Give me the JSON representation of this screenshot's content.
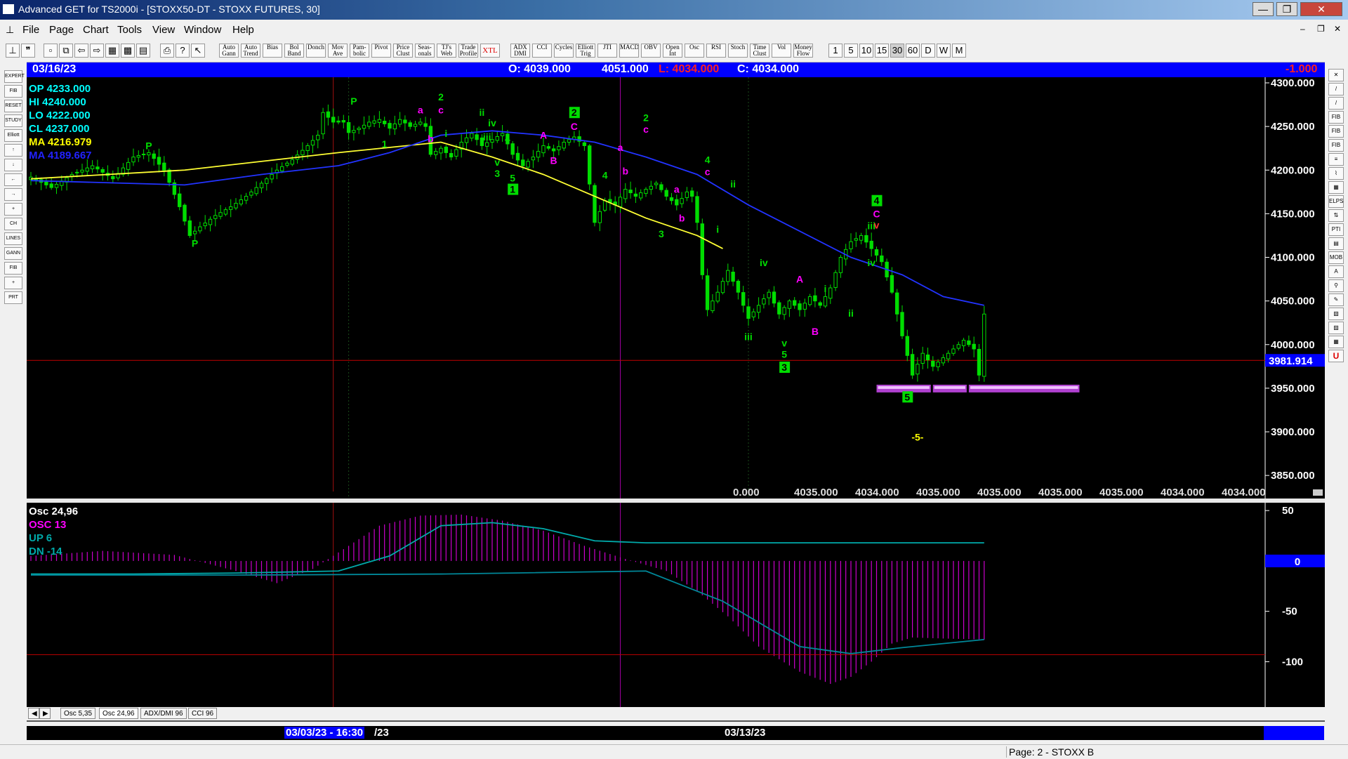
{
  "window": {
    "title": "Advanced GET for TS2000i - [STOXX50-DT - STOXX FUTURES, 30]",
    "controls": [
      "—",
      "❐",
      "✕"
    ]
  },
  "menu": [
    "File",
    "Page",
    "Chart",
    "Tools",
    "View",
    "Window",
    "Help"
  ],
  "toolbar": {
    "studies": [
      "Auto Gann",
      "Auto Trend",
      "Bias",
      "Bol Band",
      "Donch",
      "Mov Ave",
      "Pam-bolic",
      "Pivot",
      "Price Clust",
      "Seas-onals",
      "TJ's Web",
      "Trade Profile",
      "XTL",
      "ADX DMI",
      "CCI",
      "Cycles",
      "Elliott Trig",
      "JTI",
      "MACD",
      "OBV",
      "Open Int",
      "Osc",
      "RSI",
      "Stoch",
      "Time Clust",
      "Vol",
      "Money Flow"
    ],
    "intervals": [
      "1",
      "5",
      "10",
      "15",
      "30",
      "60",
      "D",
      "W",
      "M"
    ],
    "selected_interval": "30"
  },
  "left_tools": [
    "EXPERT",
    "FIB",
    "RESET",
    "STUDY",
    "Elliott",
    "↑",
    "↓",
    "←",
    "→",
    "+",
    "CH",
    "LINES",
    "GANN",
    "FIB",
    "+",
    "PRT"
  ],
  "right_tools": [
    "✕",
    "/",
    "/",
    "FIB RET",
    "FIB EXT",
    "FIB TIME",
    "≡",
    "⌇",
    "▦",
    "ELPS",
    "⇅",
    "PTI",
    "▤",
    "MOB",
    "A",
    "⚲",
    "✎",
    "▧",
    "▨",
    "▦",
    "U"
  ],
  "info_bar": {
    "date": "03/16/23",
    "open": "O: 4039.000",
    "high": "4051.000",
    "low": "L: 4034.000",
    "close": "C: 4034.000",
    "change": "-1.000"
  },
  "price_legend": [
    {
      "text": "OP  4233.000",
      "color": "#00ffff"
    },
    {
      "text": "HI   4240.000",
      "color": "#00ffff"
    },
    {
      "text": "LO  4222.000",
      "color": "#00ffff"
    },
    {
      "text": "CL  4237.000",
      "color": "#00ffff"
    },
    {
      "text": "MA  4216.979",
      "color": "#ffff00"
    },
    {
      "text": "MA  4189.667",
      "color": "#2222ff"
    }
  ],
  "cursor_price": "3981.914",
  "price_footer": [
    "0.000",
    "4035.000",
    "4034.000",
    "4035.000",
    "4035.000",
    "4035.000",
    "4035.000",
    "4034.000",
    "4034.000"
  ],
  "osc_legend": [
    {
      "text": "Osc 24,96",
      "color": "#ffffff"
    },
    {
      "text": "OSC 13",
      "color": "#ff00ff"
    },
    {
      "text": "UP   6",
      "color": "#00aaaa"
    },
    {
      "text": "DN   -14",
      "color": "#00aaaa"
    }
  ],
  "osc_zero_label": "0",
  "tabs": [
    "Osc 5,35",
    "Osc 24,96",
    "ADX/DMI 96",
    "CCI 96"
  ],
  "selected_tab": "Osc 24,96",
  "date_axis": [
    "03/03/23 - 16:30",
    "/23",
    "03/13/23"
  ],
  "status": "Page: 2 - STOXX B",
  "chart_data": [
    {
      "type": "candlestick",
      "title": "STOXX50-DT - STOXX FUTURES, 30",
      "ylim": [
        3830,
        4300
      ],
      "yticks": [
        3850,
        3900,
        3950,
        4000,
        4050,
        4100,
        4150,
        4200,
        4250,
        4300
      ],
      "ytick_labels": [
        "3850.000",
        "3900.000",
        "3950.000",
        "4000.000",
        "4050.000",
        "4100.000",
        "4150.000",
        "4200.000",
        "4250.000",
        "4300.000"
      ],
      "bar_count": 122,
      "close_path": [
        [
          0,
          4192
        ],
        [
          4,
          4180
        ],
        [
          8,
          4195
        ],
        [
          12,
          4205
        ],
        [
          16,
          4190
        ],
        [
          20,
          4215
        ],
        [
          23,
          4220
        ],
        [
          26,
          4200
        ],
        [
          29,
          4158
        ],
        [
          31,
          4125
        ],
        [
          33,
          4135
        ],
        [
          36,
          4148
        ],
        [
          39,
          4158
        ],
        [
          42,
          4170
        ],
        [
          45,
          4185
        ],
        [
          48,
          4200
        ],
        [
          51,
          4212
        ],
        [
          54,
          4228
        ],
        [
          56,
          4240
        ],
        [
          57,
          4266
        ],
        [
          59,
          4255
        ],
        [
          61,
          4255
        ],
        [
          62,
          4243
        ],
        [
          64,
          4248
        ],
        [
          66,
          4255
        ],
        [
          68,
          4258
        ],
        [
          70,
          4248
        ],
        [
          72,
          4258
        ],
        [
          74,
          4250
        ],
        [
          76,
          4255
        ],
        [
          77,
          4250
        ],
        [
          78,
          4218
        ],
        [
          80,
          4225
        ],
        [
          82,
          4215
        ],
        [
          84,
          4232
        ],
        [
          86,
          4242
        ],
        [
          88,
          4228
        ],
        [
          90,
          4235
        ],
        [
          92,
          4242
        ],
        [
          94,
          4218
        ],
        [
          96,
          4205
        ],
        [
          98,
          4215
        ],
        [
          100,
          4228
        ],
        [
          102,
          4222
        ],
        [
          104,
          4232
        ],
        [
          106,
          4238
        ],
        [
          108,
          4228
        ],
        [
          110,
          4140
        ],
        [
          112,
          4165
        ],
        [
          114,
          4160
        ],
        [
          116,
          4178
        ],
        [
          118,
          4170
        ],
        [
          120,
          4178
        ],
        [
          122,
          4185
        ],
        [
          124,
          4170
        ],
        [
          126,
          4160
        ],
        [
          128,
          4175
        ],
        [
          129,
          4170
        ],
        [
          130,
          4140
        ],
        [
          131,
          4080
        ],
        [
          132,
          4040
        ],
        [
          134,
          4060
        ],
        [
          136,
          4085
        ],
        [
          138,
          4060
        ],
        [
          140,
          4030
        ],
        [
          142,
          4045
        ],
        [
          144,
          4060
        ],
        [
          146,
          4035
        ],
        [
          148,
          4050
        ],
        [
          150,
          4040
        ],
        [
          152,
          4055
        ],
        [
          154,
          4045
        ],
        [
          156,
          4065
        ],
        [
          158,
          4100
        ],
        [
          160,
          4118
        ],
        [
          162,
          4125
        ],
        [
          164,
          4110
        ],
        [
          166,
          4095
        ],
        [
          168,
          4060
        ],
        [
          170,
          4010
        ],
        [
          172,
          3965
        ],
        [
          174,
          3990
        ],
        [
          176,
          3975
        ],
        [
          178,
          3985
        ],
        [
          180,
          3995
        ],
        [
          182,
          4005
        ],
        [
          184,
          3995
        ],
        [
          185,
          3965
        ],
        [
          186,
          4035
        ]
      ],
      "ma_yellow": {
        "label": "MA 4216.979",
        "points": [
          [
            0,
            4190
          ],
          [
            30,
            4200
          ],
          [
            60,
            4220
          ],
          [
            80,
            4232
          ],
          [
            90,
            4215
          ],
          [
            100,
            4195
          ],
          [
            110,
            4170
          ],
          [
            120,
            4145
          ],
          [
            130,
            4125
          ],
          [
            135,
            4110
          ]
        ]
      },
      "ma_blue": {
        "label": "MA 4189.667",
        "points": [
          [
            0,
            4188
          ],
          [
            30,
            4183
          ],
          [
            45,
            4195
          ],
          [
            60,
            4205
          ],
          [
            70,
            4220
          ],
          [
            80,
            4240
          ],
          [
            90,
            4245
          ],
          [
            100,
            4240
          ],
          [
            110,
            4232
          ],
          [
            120,
            4215
          ],
          [
            130,
            4195
          ],
          [
            140,
            4160
          ],
          [
            150,
            4130
          ],
          [
            160,
            4100
          ],
          [
            170,
            4080
          ],
          [
            178,
            4055
          ],
          [
            186,
            4045
          ]
        ]
      },
      "horizontal_line": 3981.914,
      "vertical_lines": [
        59,
        115
      ],
      "target_boxes": [
        [
          165,
          176,
          3950
        ],
        [
          176,
          183,
          3950
        ],
        [
          183,
          205,
          3950
        ]
      ],
      "wave_labels": [
        {
          "x": 23,
          "y": 4224,
          "text": "P",
          "color": "#00dd00"
        },
        {
          "x": 32,
          "y": 4112,
          "text": "P",
          "color": "#00dd00"
        },
        {
          "x": 63,
          "y": 4275,
          "text": "P",
          "color": "#00dd00"
        },
        {
          "x": 69,
          "y": 4226,
          "text": "1",
          "color": "#00dd00"
        },
        {
          "x": 76,
          "y": 4265,
          "text": "a",
          "color": "#ff00ff"
        },
        {
          "x": 78,
          "y": 4232,
          "text": "b",
          "color": "#ff00ff"
        },
        {
          "x": 80,
          "y": 4280,
          "text": "2",
          "color": "#00dd00"
        },
        {
          "x": 80,
          "y": 4265,
          "text": "c",
          "color": "#ff00ff"
        },
        {
          "x": 81,
          "y": 4238,
          "text": "i",
          "color": "#00dd00"
        },
        {
          "x": 88,
          "y": 4262,
          "text": "ii",
          "color": "#00dd00"
        },
        {
          "x": 90,
          "y": 4250,
          "text": "iv",
          "color": "#00dd00"
        },
        {
          "x": 89,
          "y": 4234,
          "text": "iii",
          "color": "#00dd00"
        },
        {
          "x": 91,
          "y": 4205,
          "text": "v",
          "color": "#00dd00"
        },
        {
          "x": 91,
          "y": 4192,
          "text": "3",
          "color": "#00dd00"
        },
        {
          "x": 93,
          "y": 4232,
          "text": "4",
          "color": "#00dd00"
        },
        {
          "x": 94,
          "y": 4187,
          "text": "5",
          "color": "#00dd00"
        },
        {
          "x": 94,
          "y": 4174,
          "text": "1",
          "color": "#00dd00",
          "box": true
        },
        {
          "x": 100,
          "y": 4236,
          "text": "A",
          "color": "#ff00ff"
        },
        {
          "x": 102,
          "y": 4207,
          "text": "B",
          "color": "#ff00ff"
        },
        {
          "x": 106,
          "y": 4262,
          "text": "2",
          "color": "#00dd00",
          "box": true
        },
        {
          "x": 106,
          "y": 4246,
          "text": "C",
          "color": "#ff00ff"
        },
        {
          "x": 112,
          "y": 4190,
          "text": "4",
          "color": "#00dd00"
        },
        {
          "x": 115,
          "y": 4222,
          "text": "a",
          "color": "#ff00ff"
        },
        {
          "x": 116,
          "y": 4195,
          "text": "b",
          "color": "#ff00ff"
        },
        {
          "x": 120,
          "y": 4256,
          "text": "2",
          "color": "#00dd00"
        },
        {
          "x": 120,
          "y": 4243,
          "text": "c",
          "color": "#ff00ff"
        },
        {
          "x": 123,
          "y": 4123,
          "text": "3",
          "color": "#00dd00"
        },
        {
          "x": 126,
          "y": 4174,
          "text": "a",
          "color": "#ff00ff"
        },
        {
          "x": 127,
          "y": 4141,
          "text": "b",
          "color": "#ff00ff"
        },
        {
          "x": 132,
          "y": 4208,
          "text": "4",
          "color": "#00dd00"
        },
        {
          "x": 132,
          "y": 4194,
          "text": "c",
          "color": "#ff00ff"
        },
        {
          "x": 134,
          "y": 4128,
          "text": "i",
          "color": "#00dd00"
        },
        {
          "x": 137,
          "y": 4180,
          "text": "ii",
          "color": "#00dd00"
        },
        {
          "x": 140,
          "y": 4005,
          "text": "iii",
          "color": "#00dd00"
        },
        {
          "x": 143,
          "y": 4090,
          "text": "iv",
          "color": "#00dd00"
        },
        {
          "x": 147,
          "y": 3998,
          "text": "v",
          "color": "#00dd00"
        },
        {
          "x": 147,
          "y": 3985,
          "text": "5",
          "color": "#00dd00"
        },
        {
          "x": 147,
          "y": 3970,
          "text": "3",
          "color": "#00dd00",
          "box": true
        },
        {
          "x": 150,
          "y": 4071,
          "text": "A",
          "color": "#ff00ff"
        },
        {
          "x": 153,
          "y": 4011,
          "text": "B",
          "color": "#ff00ff"
        },
        {
          "x": 155,
          "y": 4060,
          "text": "i",
          "color": "#00dd00"
        },
        {
          "x": 160,
          "y": 4032,
          "text": "ii",
          "color": "#00dd00"
        },
        {
          "x": 164,
          "y": 4132,
          "text": "iii",
          "color": "#00dd00"
        },
        {
          "x": 165,
          "y": 4161,
          "text": "4",
          "color": "#00dd00",
          "box": true
        },
        {
          "x": 165,
          "y": 4146,
          "text": "C",
          "color": "#ff00ff"
        },
        {
          "x": 165,
          "y": 4133,
          "text": "v",
          "color": "#ff3333"
        },
        {
          "x": 164,
          "y": 4090,
          "text": "iv",
          "color": "#00dd00"
        },
        {
          "x": 171,
          "y": 3936,
          "text": "5",
          "color": "#00dd00",
          "box": true
        },
        {
          "x": 173,
          "y": 3890,
          "text": "-5-",
          "color": "#ffff00"
        }
      ]
    },
    {
      "type": "bar",
      "title": "Osc 24,96",
      "ylim": [
        -145,
        55
      ],
      "yticks": [
        50,
        0,
        -50,
        -100
      ],
      "ytick_labels": [
        "50",
        "0",
        "-50",
        "-100"
      ],
      "osc_path": [
        [
          0,
          5
        ],
        [
          14,
          10
        ],
        [
          28,
          6
        ],
        [
          40,
          -10
        ],
        [
          48,
          -22
        ],
        [
          55,
          -8
        ],
        [
          62,
          15
        ],
        [
          68,
          35
        ],
        [
          76,
          45
        ],
        [
          84,
          46
        ],
        [
          92,
          40
        ],
        [
          100,
          30
        ],
        [
          108,
          15
        ],
        [
          116,
          2
        ],
        [
          124,
          -10
        ],
        [
          130,
          -30
        ],
        [
          136,
          -55
        ],
        [
          142,
          -85
        ],
        [
          150,
          -110
        ],
        [
          156,
          -122
        ],
        [
          160,
          -115
        ],
        [
          164,
          -100
        ],
        [
          168,
          -82
        ],
        [
          172,
          -76
        ],
        [
          178,
          -77
        ],
        [
          186,
          -78
        ]
      ],
      "up_line": [
        [
          0,
          -13
        ],
        [
          20,
          -13
        ],
        [
          40,
          -12
        ],
        [
          50,
          -11
        ],
        [
          60,
          -10
        ],
        [
          70,
          5
        ],
        [
          80,
          35
        ],
        [
          90,
          38
        ],
        [
          100,
          32
        ],
        [
          110,
          20
        ],
        [
          120,
          18
        ],
        [
          186,
          18
        ]
      ],
      "dn_line": [
        [
          0,
          -14
        ],
        [
          40,
          -14
        ],
        [
          80,
          -13
        ],
        [
          120,
          -10
        ],
        [
          135,
          -40
        ],
        [
          150,
          -85
        ],
        [
          160,
          -92
        ],
        [
          170,
          -86
        ],
        [
          186,
          -78
        ]
      ],
      "horizontal_line": -93,
      "vertical_lines": [
        59,
        115
      ]
    }
  ]
}
